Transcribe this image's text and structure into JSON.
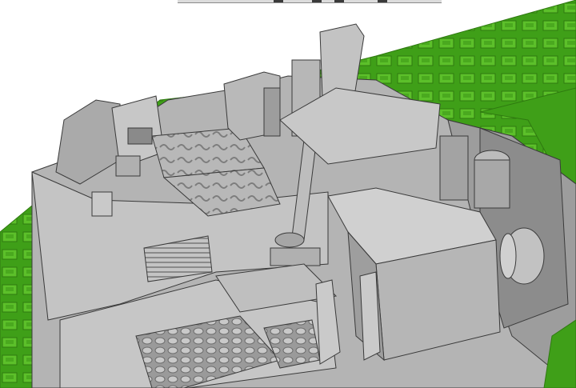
{
  "viewport": {
    "view_mode": "3d-shaded",
    "colors": {
      "background": "#ffffff",
      "base_plate": "#3f9f18",
      "base_plate_dark": "#2f7a10",
      "base_plate_light": "#5cc02a",
      "model_light": "#c9c9c9",
      "model_mid": "#a9a9a9",
      "model_dark": "#7d7d7d",
      "edge": "#3a3a3a"
    }
  }
}
